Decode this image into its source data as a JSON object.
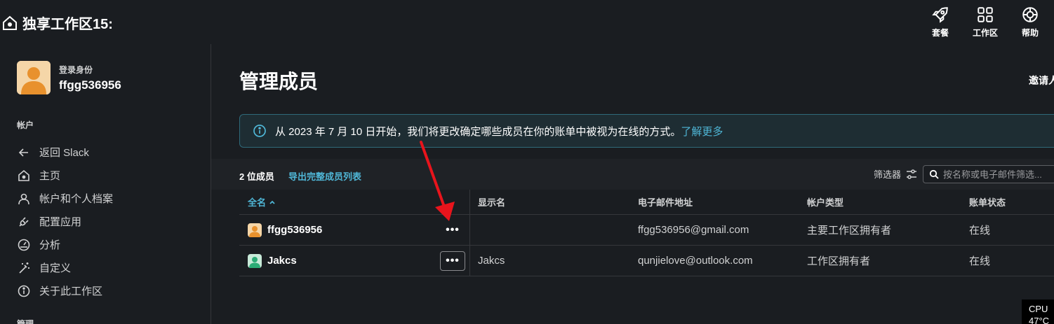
{
  "workspace": {
    "title": "独享工作区15:"
  },
  "top_actions": [
    {
      "label": "套餐",
      "icon": "rocket-icon"
    },
    {
      "label": "工作区",
      "icon": "grid-icon"
    },
    {
      "label": "帮助",
      "icon": "lifebuoy-icon"
    }
  ],
  "profile": {
    "label": "登录身份",
    "name": "ffgg536956"
  },
  "sidebar": {
    "account_section": "帐户",
    "items": [
      {
        "label": "返回 Slack",
        "icon": "back-arrow-icon"
      },
      {
        "label": "主页",
        "icon": "home-icon"
      },
      {
        "label": "帐户和个人档案",
        "icon": "user-icon"
      },
      {
        "label": "配置应用",
        "icon": "plug-icon"
      },
      {
        "label": "分析",
        "icon": "gauge-icon"
      },
      {
        "label": "自定义",
        "icon": "magic-wand-icon"
      },
      {
        "label": "关于此工作区",
        "icon": "info-icon"
      }
    ],
    "manage_section": "管理"
  },
  "main": {
    "title": "管理成员",
    "invite_label": "邀请人",
    "banner": {
      "text": "从 2023 年 7 月 10 日开始，我们将更改确定哪些成员在你的账单中被视为在线的方式。",
      "link": "了解更多"
    },
    "member_count": "2 位成员",
    "export_label": "导出完整成员列表",
    "filter_label": "筛选器",
    "search_placeholder": "按名称或电子邮件筛选..."
  },
  "table": {
    "columns": [
      "全名",
      "显示名",
      "电子邮件地址",
      "帐户类型",
      "账单状态"
    ],
    "rows": [
      {
        "name": "ffgg536956",
        "display": "",
        "email": "ffgg536956@gmail.com",
        "type": "主要工作区拥有者",
        "status": "在线",
        "avatar_color": "#e8912d"
      },
      {
        "name": "Jakcs",
        "display": "Jakcs",
        "email": "qunjielove@outlook.com",
        "type": "工作区拥有者",
        "status": "在线",
        "avatar_color": "#2bac76"
      }
    ],
    "more_label": "•••"
  },
  "system": {
    "cpu_label": "CPU",
    "cpu_temp": "47°C"
  },
  "colors": {
    "accent": "#4fb6d6",
    "annotation": "#e8141c"
  }
}
